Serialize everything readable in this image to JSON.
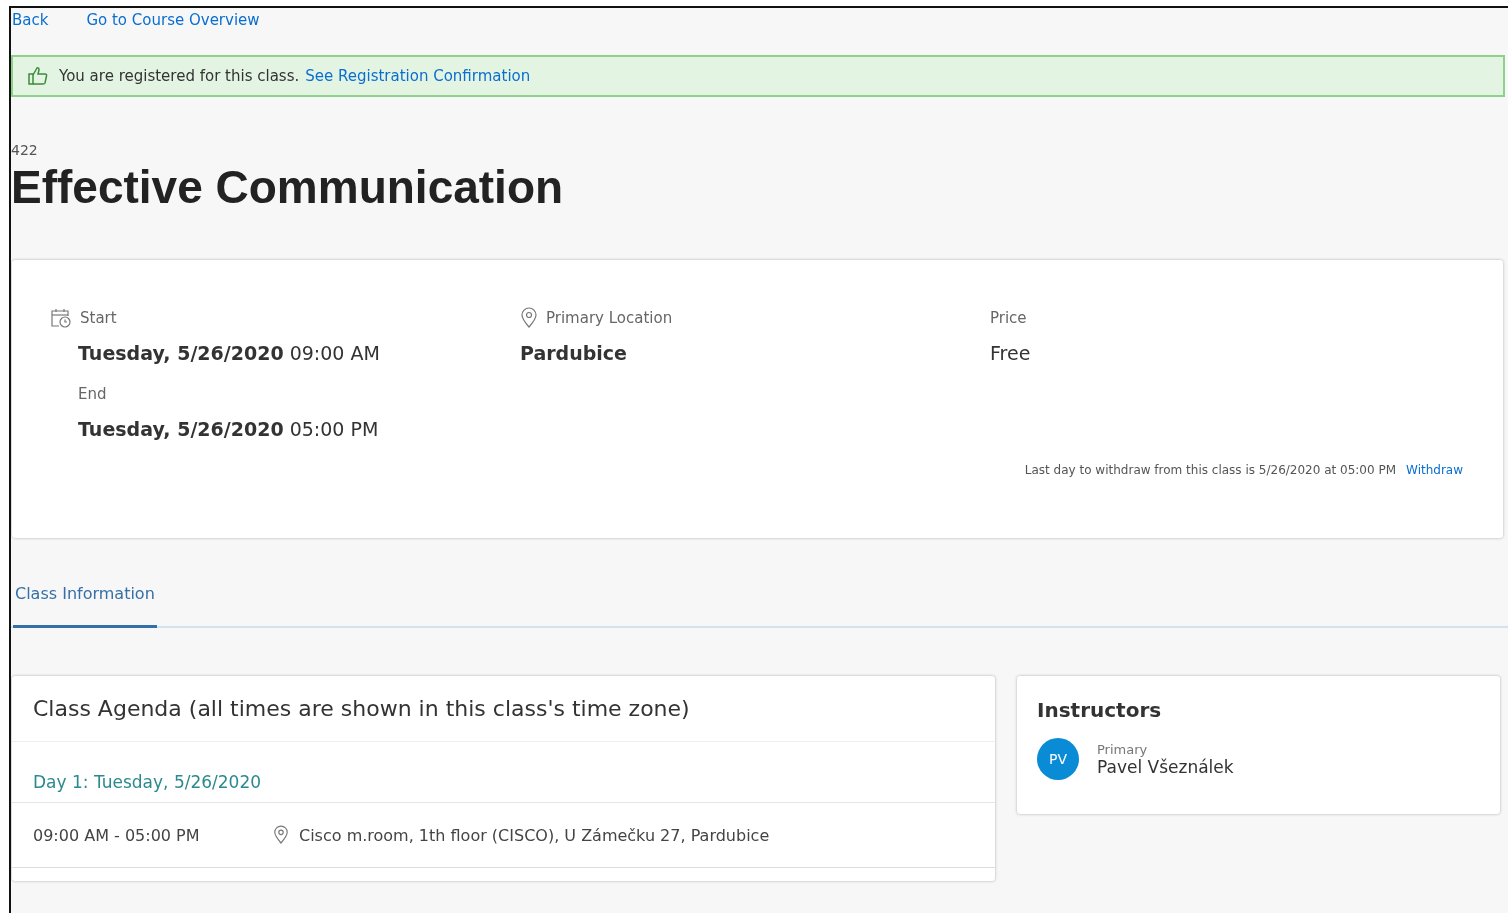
{
  "nav_links": [
    "Back",
    "Go to Course Overview"
  ],
  "banner": {
    "text": "You are registered for this class.",
    "link": "See Registration Confirmation"
  },
  "course_number": "422",
  "title": "Effective Communication",
  "details": {
    "start": {
      "label": "Start",
      "date": "Tuesday, 5/26/2020",
      "time": "09:00 AM"
    },
    "end": {
      "label": "End",
      "date": "Tuesday, 5/26/2020",
      "time": "05:00 PM"
    },
    "location": {
      "label": "Primary Location",
      "value": "Pardubice"
    },
    "price": {
      "label": "Price",
      "value": "Free"
    },
    "withdraw": {
      "text": "Last day to withdraw from this class is 5/26/2020 at 05:00 PM",
      "link": "Withdraw"
    }
  },
  "tabs": [
    {
      "label": "Class Information",
      "selected": true
    }
  ],
  "agenda": {
    "title": "Class Agenda (all times are shown in this class's time zone)",
    "days": [
      {
        "heading": "Day 1: Tuesday, 5/26/2020",
        "sessions": [
          {
            "time": "09:00 AM - 05:00 PM",
            "location": "Cisco m.room, 1th floor (CISCO), U Zámečku 27, Pardubice"
          }
        ]
      }
    ]
  },
  "instructors": {
    "title": "Instructors",
    "people": [
      {
        "initials": "PV",
        "role": "Primary",
        "name": "Pavel Všeználek"
      }
    ]
  }
}
